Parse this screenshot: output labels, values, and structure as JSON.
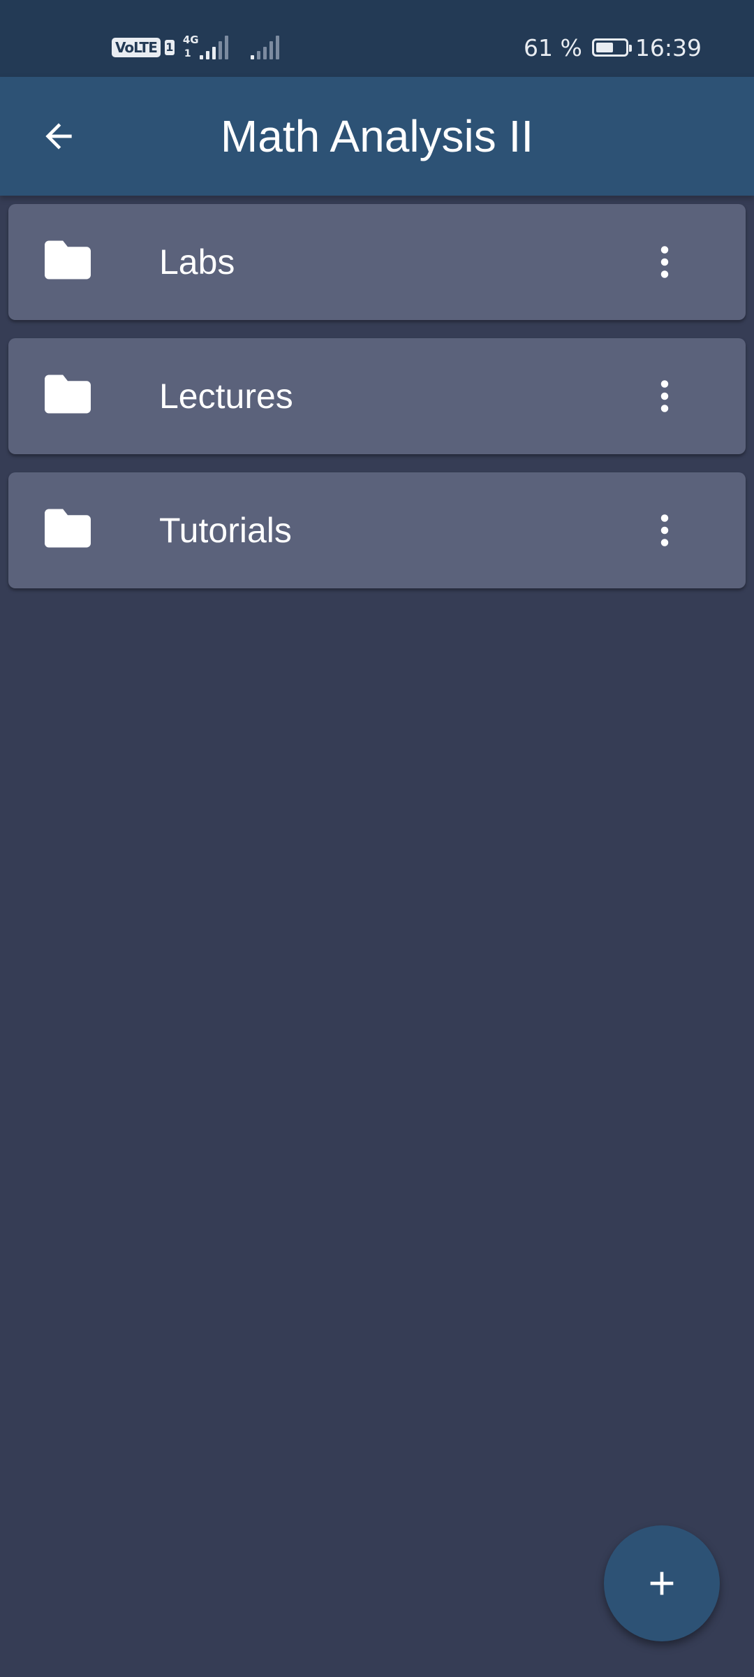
{
  "status_bar": {
    "volte_label": "VoLTE",
    "sim_slot": "1",
    "network_type": "4G",
    "network_sub": "1",
    "battery_text": "61 %",
    "battery_level": 0.61,
    "time": "16:39"
  },
  "app_bar": {
    "title": "Math Analysis II",
    "back_icon": "arrow-back-icon"
  },
  "folders": [
    {
      "label": "Labs",
      "icon": "folder-icon",
      "menu_icon": "more-vert-icon"
    },
    {
      "label": "Lectures",
      "icon": "folder-icon",
      "menu_icon": "more-vert-icon"
    },
    {
      "label": "Tutorials",
      "icon": "folder-icon",
      "menu_icon": "more-vert-icon"
    }
  ],
  "fab": {
    "icon": "plus-icon"
  },
  "colors": {
    "background": "#363d55",
    "status_bar": "#233a55",
    "app_bar": "#2d5275",
    "card": "#5b627b",
    "fab": "#2d5275",
    "foreground": "#ffffff"
  }
}
